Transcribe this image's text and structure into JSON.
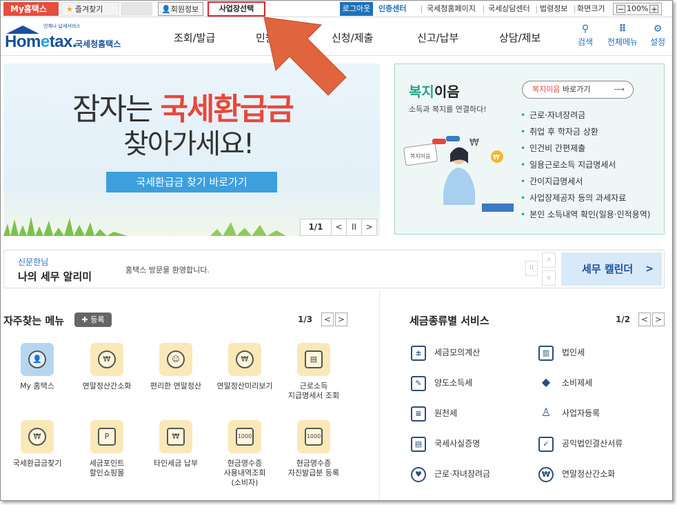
{
  "topbar": {
    "my_hometax": "My홈택스",
    "favorites": "즐겨찾기",
    "member_info": "회원정보",
    "business_select": "사업장선택",
    "logout": "로그아웃",
    "cert_center": "인증센터",
    "links": [
      "국세청홈페이지",
      "국세상담센터",
      "법령정보",
      "화면크기"
    ],
    "zoom_minus": "−",
    "zoom_value": "100%",
    "zoom_plus": "+"
  },
  "header": {
    "logo_sub": "언제나 납세서비스",
    "logo_main_pre": "Hom",
    "logo_main_e": "e",
    "logo_main_post": "tax.",
    "logo_kr": "국세청홈택스",
    "nav": [
      "조회/발급",
      "민원증명",
      "신청/제출",
      "신고/납부",
      "상담/제보"
    ],
    "icons": [
      {
        "label": "검색",
        "glyph": "⚲"
      },
      {
        "label": "전체메뉴",
        "glyph": "⠿"
      },
      {
        "label": "설정",
        "glyph": "⚙"
      }
    ]
  },
  "banner": {
    "line1_pre": "잠자는 ",
    "line1_red": "국세환급금",
    "line2": "찾아가세요!",
    "button": "국세환급금 찾기 바로가기",
    "pager": "1/1",
    "prev": "<",
    "pause": "II",
    "next": ">"
  },
  "welfare": {
    "title_color": "복지",
    "title_black": "이음",
    "subtitle": "소득과 복지를 연결하다!",
    "button_hl": "복지이음",
    "button_rest": " 바로가기",
    "items": [
      "근로·자녀장려금",
      "취업 후 학자금 상환",
      "인건비 간편제출",
      "일용근로소득 지급명세서",
      "간이지급명세서",
      "사업장제공자 등의 과세자료",
      "본인 소득내역 확인(일용·인적용역)"
    ],
    "illustration_text": "복지이음"
  },
  "notice": {
    "name": "신문한님",
    "title": "나의 세무 알리미",
    "message": "홈택스 방문을 환영합니다.",
    "pause": "II",
    "up": "∧",
    "down": "∨",
    "calendar": "세무 캘린더",
    "calendar_arrow": ">"
  },
  "favorites_menu": {
    "title": "자주찾는 메뉴",
    "add": "등록",
    "page": "1/3",
    "prev": "<",
    "next": ">",
    "items": [
      {
        "label": "My 홈택스",
        "glyph": "👤"
      },
      {
        "label": "연말정산간소화",
        "glyph": "₩"
      },
      {
        "label": "편리한 연말정산",
        "glyph": "☺"
      },
      {
        "label": "연말정산미리보기",
        "glyph": "₩"
      },
      {
        "label": "근로소득\n지급명세서 조회",
        "glyph": "▤"
      },
      {
        "label": "국세환급금찾기",
        "glyph": "₩"
      },
      {
        "label": "세금포인트\n할인쇼핑몰",
        "glyph": "P"
      },
      {
        "label": "타인세금 납부",
        "glyph": "₩"
      },
      {
        "label": "현금영수증\n사용내역조회\n(소비자)",
        "glyph": "1000"
      },
      {
        "label": "현금영수증\n자진발급분 등록",
        "glyph": "1000"
      }
    ]
  },
  "tax_service": {
    "title": "세금종류별 서비스",
    "page": "1/2",
    "prev": "<",
    "next": ">",
    "items": [
      {
        "label": "세금모의계산",
        "glyph": "±"
      },
      {
        "label": "법인세",
        "glyph": "▥"
      },
      {
        "label": "양도소득세",
        "glyph": "✎"
      },
      {
        "label": "소비제세",
        "glyph": "◆"
      },
      {
        "label": "원천세",
        "glyph": "≡"
      },
      {
        "label": "사업자등록",
        "glyph": "♙"
      },
      {
        "label": "국세사실증명",
        "glyph": "▤"
      },
      {
        "label": "공익법인결산서류",
        "glyph": "✓"
      },
      {
        "label": "근로·자녀장려금",
        "glyph": "♥"
      },
      {
        "label": "연말정산간소화",
        "glyph": "₩"
      }
    ]
  },
  "colors": {
    "brand_blue": "#1a4f9c",
    "accent_red": "#e8483a",
    "highlight_border": "#e0242b",
    "annotation_arrow": "#e0643e"
  }
}
